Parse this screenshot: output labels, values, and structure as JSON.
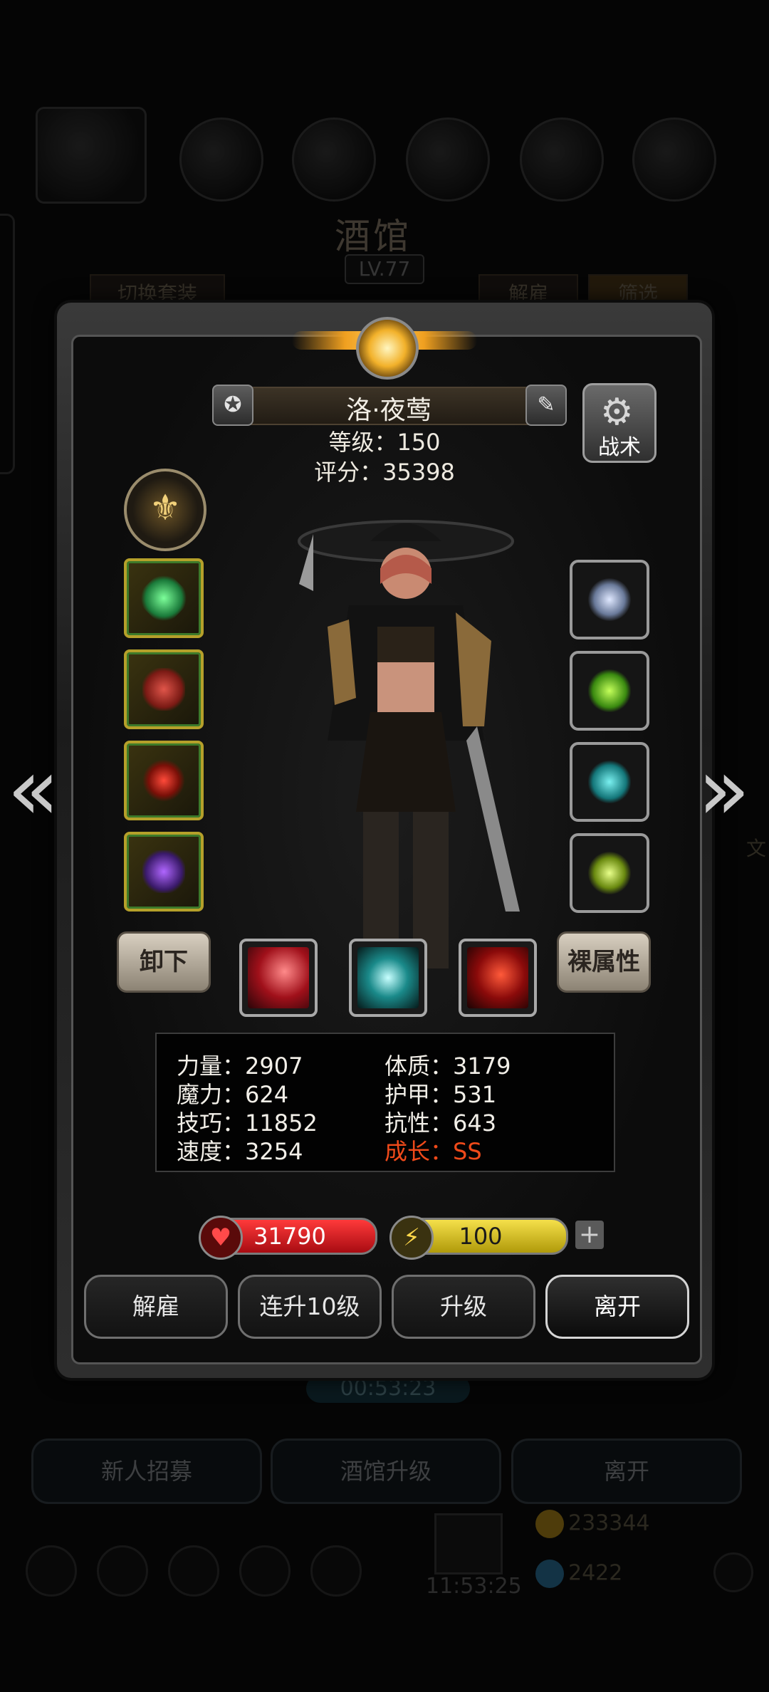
{
  "background": {
    "title": "酒馆",
    "level_badge": "LV.77",
    "tab_switch_outfit": "切换套装",
    "tab_dismiss": "解雇",
    "tab_filter": "筛选",
    "timer_small": "00:53:23",
    "btn_recruit": "新人招募",
    "btn_tavern_upgrade": "酒馆升级",
    "btn_leave": "离开",
    "gold_amount": "233344",
    "gem_amount": "2422",
    "gift_timer": "11:53:25",
    "side_label": "文"
  },
  "hero": {
    "name": "洛·夜莺",
    "level_line": "等级：150",
    "score_line": "评分：35398",
    "tactics_label": "战术",
    "unequip_label": "卸下",
    "bare_attr_label": "裸属性"
  },
  "equipment_left": [
    "green-spear-icon",
    "red-armor-icon",
    "ruby-necklace-icon",
    "purple-crown-icon"
  ],
  "equipment_right": [
    "silver-ring-icon",
    "green-crystal-icon",
    "cyan-gem-icon",
    "green-lantern-icon"
  ],
  "skills": [
    "red-slash-skill-icon",
    "cyan-swirl-skill-icon",
    "red-blade-skill-icon"
  ],
  "stats": {
    "strength": "力量：2907",
    "constitution": "体质：3179",
    "magic": "魔力：624",
    "armor": "护甲：531",
    "skill": "技巧：11852",
    "resistance": "抗性：643",
    "speed": "速度：3254",
    "growth": "成长：SS"
  },
  "bars": {
    "hp": "31790",
    "energy": "100"
  },
  "actions": {
    "dismiss": "解雇",
    "level_up_10": "连升10级",
    "level_up": "升级",
    "leave": "离开"
  },
  "colors": {
    "growth": "#f04a1a",
    "hp_bar": "#c8161c",
    "energy_bar": "#d9c21a",
    "equip_border": "#b5a02a"
  }
}
